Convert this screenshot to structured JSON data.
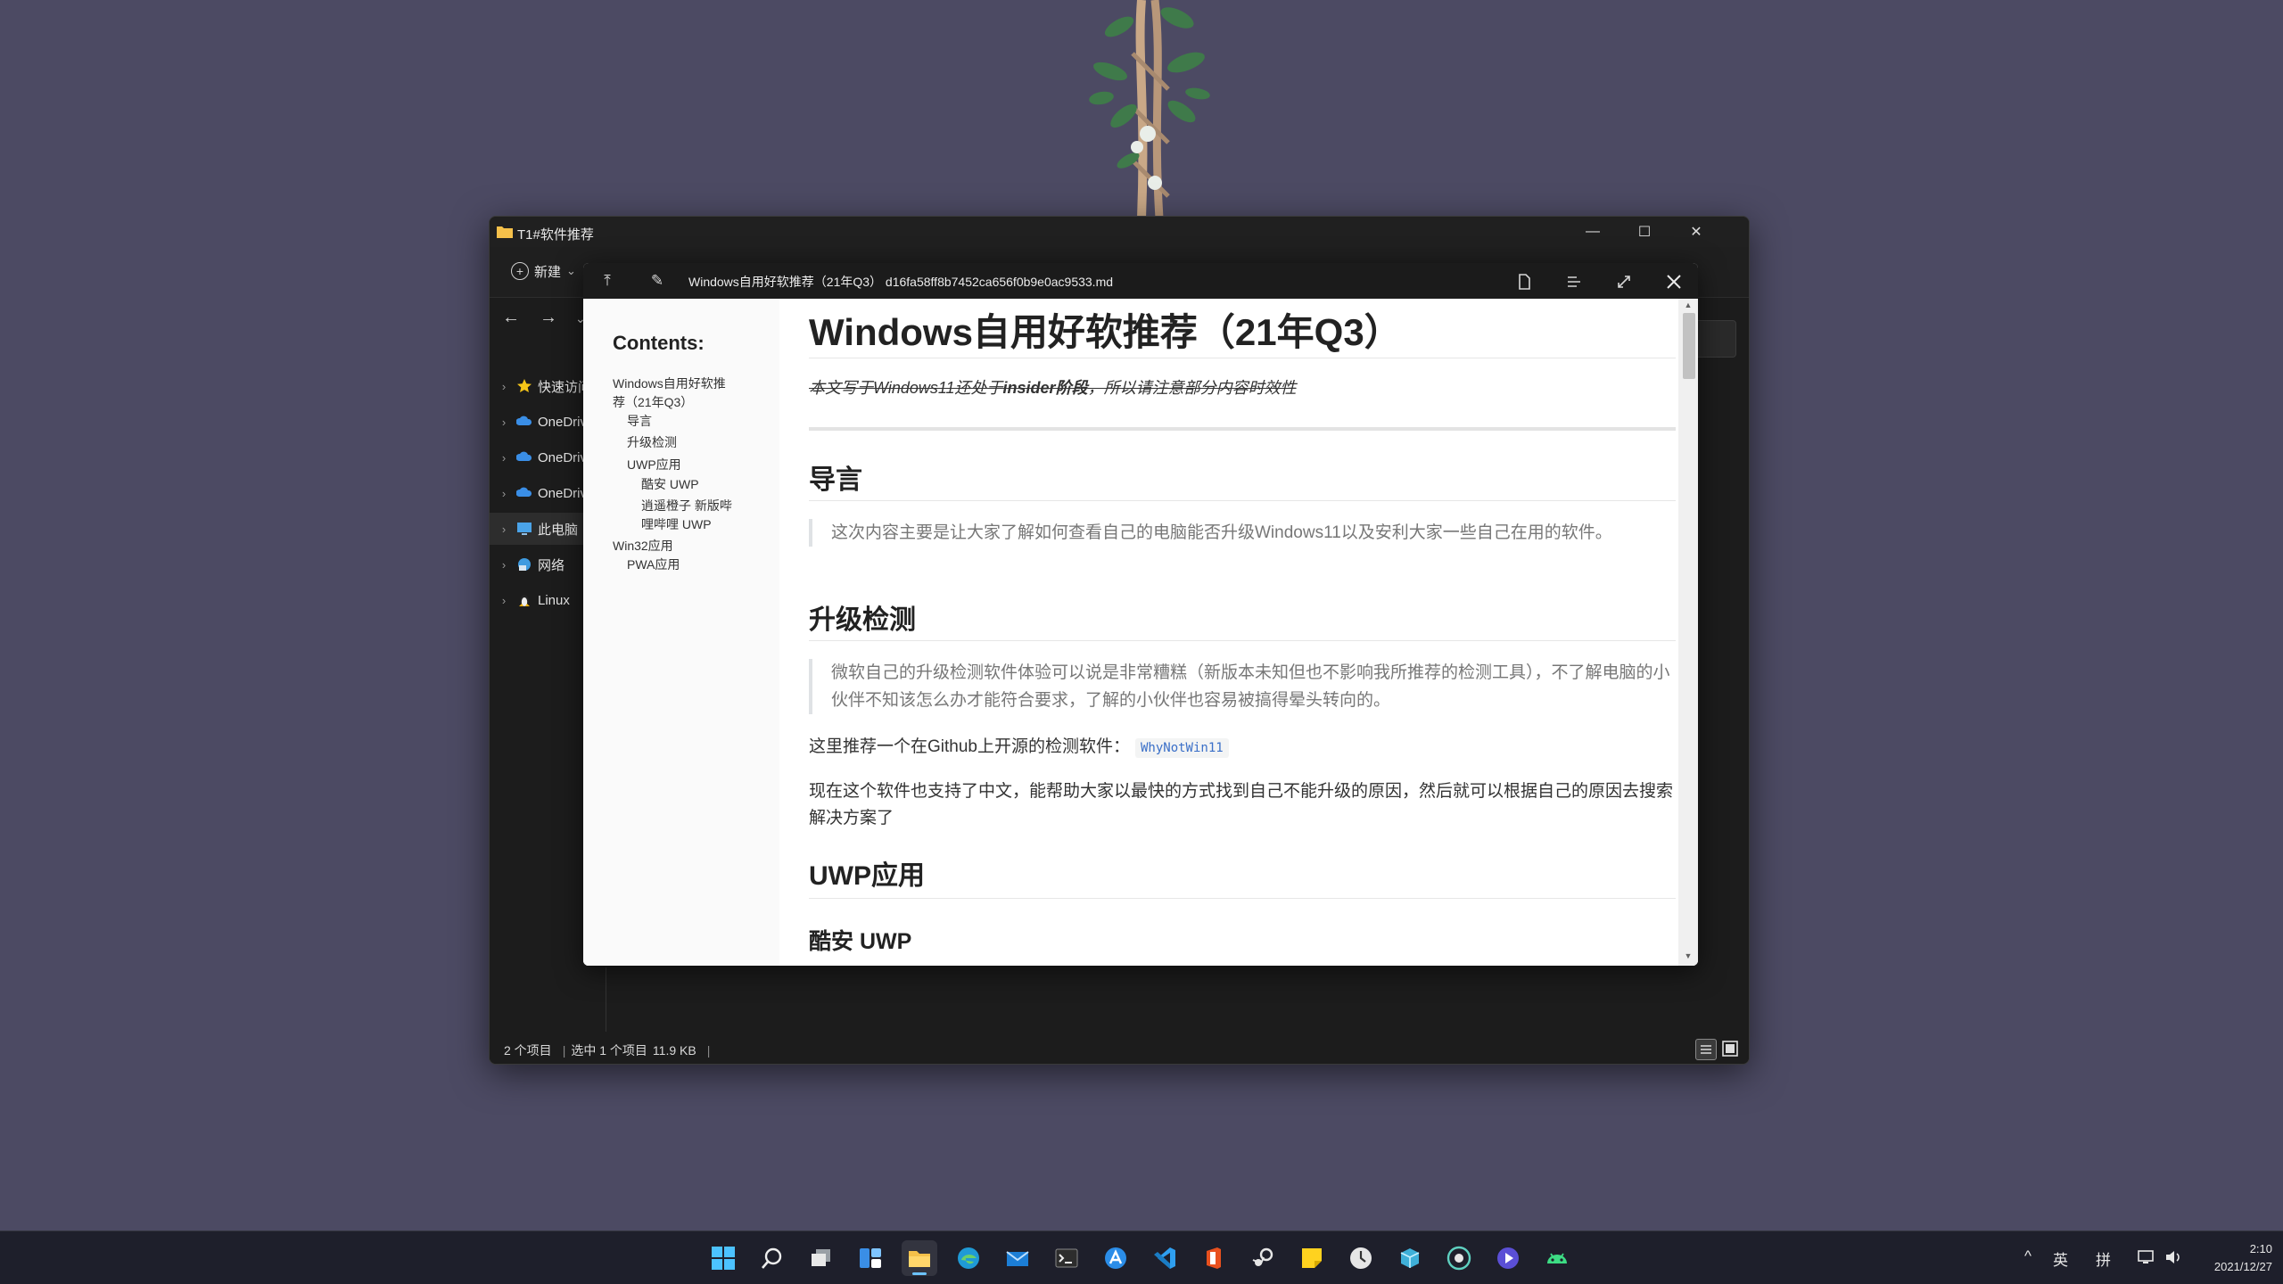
{
  "explorer": {
    "title": "T1#软件推荐",
    "toolbar": {
      "new_label": "新建",
      "new_chevron": "⌄"
    },
    "nav": {
      "back": "←",
      "forward": "→",
      "chevron": "⌄"
    },
    "sidebar": [
      {
        "label": "快速访问",
        "icon": "star-icon",
        "selected": false
      },
      {
        "label": "OneDrive",
        "icon": "onedrive-icon",
        "selected": false
      },
      {
        "label": "OneDrive",
        "icon": "onedrive-icon",
        "selected": false
      },
      {
        "label": "OneDrive",
        "icon": "onedrive-icon",
        "selected": false
      },
      {
        "label": "此电脑",
        "icon": "computer-icon",
        "selected": true
      },
      {
        "label": "网络",
        "icon": "network-icon",
        "selected": false
      },
      {
        "label": "Linux",
        "icon": "linux-icon",
        "selected": false
      }
    ],
    "status": {
      "count": "2 个项目",
      "selection": "选中 1 个项目",
      "size": "11.9 KB",
      "separator": "|"
    },
    "window_controls": {
      "minimize": "—",
      "maximize": "☐",
      "close": "✕"
    }
  },
  "preview": {
    "filename": "Windows自用好软推荐（21年Q3） d16fa58ff8b7452ca656f0b9e0ac9533.md",
    "toc": {
      "heading": "Contents:",
      "items": [
        {
          "text": "Windows自用好软推",
          "level": 0
        },
        {
          "text": "荐（21年Q3）",
          "level": 0
        },
        {
          "text": "导言",
          "level": 1
        },
        {
          "text": "升级检测",
          "level": 1
        },
        {
          "text": "UWP应用",
          "level": 1
        },
        {
          "text": "酷安 UWP",
          "level": 2
        },
        {
          "text": "逍遥橙子 新版哔",
          "level": 2
        },
        {
          "text": "哩哔哩 UWP",
          "level": 2
        },
        {
          "text": "Win32应用",
          "level": 0
        },
        {
          "text": "PWA应用",
          "level": 1
        }
      ]
    },
    "doc": {
      "title": "Windows自用好软推荐（21年Q3）",
      "note_pre": "本文写于Windows11还处于",
      "note_bold": "insider阶段",
      "note_post": "，所以请注意部分内容时效性",
      "h_intro": "导言",
      "intro_quote": "这次内容主要是让大家了解如何查看自己的电脑能否升级Windows11以及安利大家一些自己在用的软件。",
      "h_check": "升级检测",
      "check_quote": "微软自己的升级检测软件体验可以说是非常糟糕（新版本未知但也不影响我所推荐的检测工具），不了解电脑的小伙伴不知该怎么办才能符合要求，了解的小伙伴也容易被搞得晕头转向的。",
      "recommend_text": "这里推荐一个在Github上开源的检测软件：",
      "recommend_code": "WhyNotWin11",
      "support_text": "现在这个软件也支持了中文，能帮助大家以最快的方式找到自己不能升级的原因，然后就可以根据自己的原因去搜索解决方案了",
      "h_uwp": "UWP应用",
      "h_coolapk": "酷安 UWP"
    }
  },
  "taskbar": {
    "apps": [
      "windows-start-icon",
      "search-icon",
      "task-view-icon",
      "widgets-icon",
      "file-explorer-icon",
      "edge-icon",
      "mail-icon",
      "terminal-icon",
      "arc-icon",
      "vscode-icon",
      "office-icon",
      "steam-icon",
      "sticky-notes-icon",
      "clock-app-icon",
      "package-icon",
      "media-app-icon",
      "play-icon",
      "android-icon"
    ],
    "tray": {
      "chevron": "^",
      "ime1": "英",
      "ime2": "拼"
    },
    "time": "2:10",
    "date": "2021/12/27"
  },
  "colors": {
    "desktop": "#4c4a63",
    "accent": "#6cc3ff",
    "taskbar": "#1e1f2b"
  }
}
